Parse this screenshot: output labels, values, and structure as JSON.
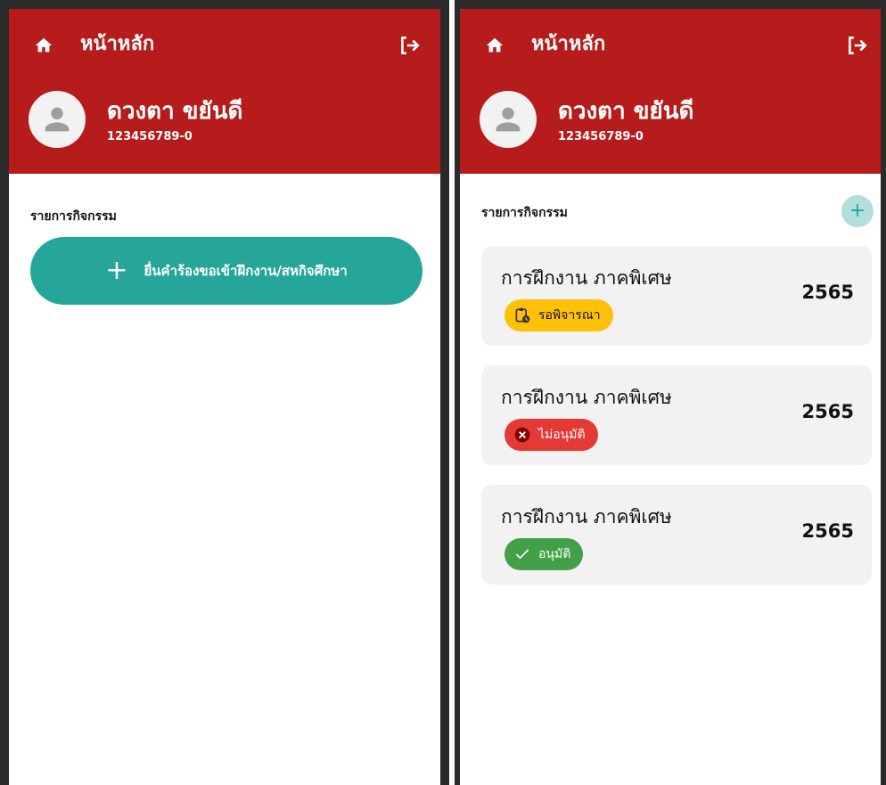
{
  "header": {
    "home_title": "หน้าหลัก",
    "user_name": "ดวงตา ขยันดี",
    "user_id": "123456789-0"
  },
  "left_panel": {
    "section_title": "รายการกิจกรรม",
    "add_request_label": "ยื่นคำร้องขอเข้าฝึกงาน/สหกิจศึกษา",
    "add_request_icon": "+"
  },
  "right_panel": {
    "section_title": "รายการกิจกรรม",
    "add_icon": "+",
    "cards": [
      {
        "title": "การฝึกงาน ภาคพิเศษ",
        "year": "2565",
        "status": "รอพิจารณา",
        "status_type": "pending"
      },
      {
        "title": "การฝึกงาน ภาคพิเศษ",
        "year": "2565",
        "status": "ไม่อนุมัติ",
        "status_type": "rejected"
      },
      {
        "title": "การฝึกงาน ภาคพิเศษ",
        "year": "2565",
        "status": "อนุมัติ",
        "status_type": "approved"
      }
    ]
  },
  "colors": {
    "header_red": "#b71c1c",
    "teal": "#26a69a",
    "pending": "#ffc107",
    "rejected": "#e53935",
    "approved": "#43a047"
  }
}
